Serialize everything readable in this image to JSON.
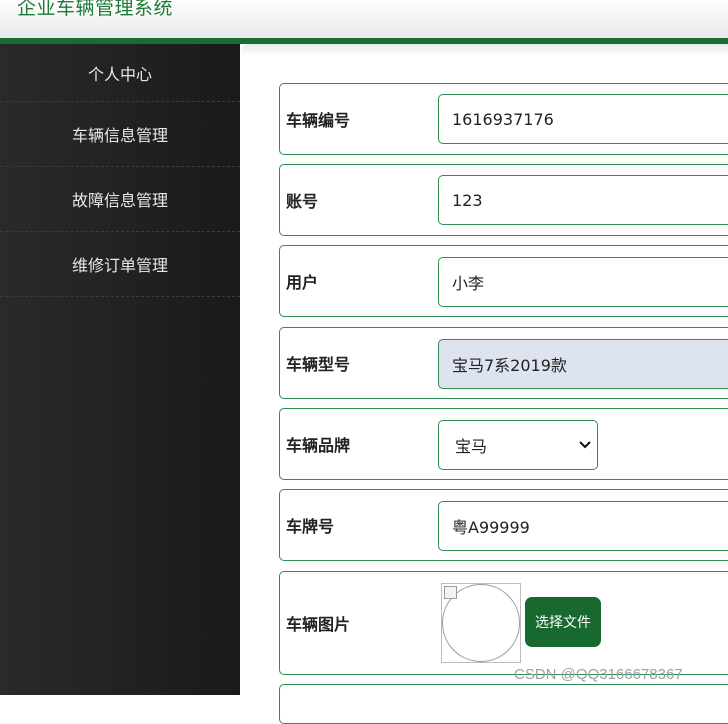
{
  "app": {
    "title": "企业车辆管理系统"
  },
  "sidebar": {
    "items": [
      {
        "label": "个人中心"
      },
      {
        "label": "车辆信息管理"
      },
      {
        "label": "故障信息管理"
      },
      {
        "label": "维修订单管理"
      }
    ]
  },
  "form": {
    "vehicle_no": {
      "label": "车辆编号",
      "value": "1616937176"
    },
    "account": {
      "label": "账号",
      "value": "123"
    },
    "user": {
      "label": "用户",
      "value": "小李"
    },
    "model": {
      "label": "车辆型号",
      "value": "宝马7系2019款"
    },
    "brand": {
      "label": "车辆品牌",
      "value": "宝马"
    },
    "plate": {
      "label": "车牌号",
      "value": "粤A99999"
    },
    "image": {
      "label": "车辆图片",
      "button": "选择文件"
    }
  },
  "watermark": "CSDN @QQ3166678367",
  "colors": {
    "accent": "#1b6b35",
    "sidebar": "#1f1f1f",
    "disabled_field": "#dde3ef"
  }
}
